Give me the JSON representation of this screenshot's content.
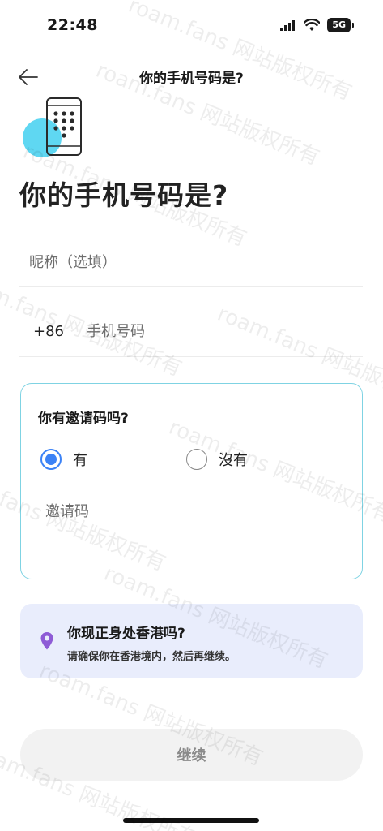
{
  "status_bar": {
    "time": "22:48",
    "battery": "5G",
    "icons": [
      "signal-icon",
      "wifi-icon",
      "battery-icon"
    ]
  },
  "nav": {
    "title": "你的手机号码是?",
    "back_icon": "back-arrow-icon"
  },
  "page": {
    "title": "你的手机号码是?",
    "hero_icon": "phone-keypad-icon"
  },
  "form": {
    "nickname_placeholder": "昵称（选填）",
    "nickname_value": "",
    "country_code": "+86",
    "phone_placeholder": "手机号码",
    "phone_value": ""
  },
  "invite": {
    "question": "你有邀请码吗?",
    "options": [
      {
        "label": "有",
        "checked": true
      },
      {
        "label": "沒有",
        "checked": false
      }
    ],
    "code_placeholder": "邀请码",
    "code_value": ""
  },
  "location": {
    "icon": "location-pin-icon",
    "title": "你现正身处香港吗?",
    "description": "请确保你在香港境内，然后再继续。"
  },
  "actions": {
    "continue_label": "继续"
  },
  "watermark": {
    "text": "roam.fans 网站版权所有"
  },
  "colors": {
    "accent": "#3b82f6",
    "card_border": "#7fd3e3",
    "location_bg": "#e9edfc",
    "pin": "#8e5bd6",
    "hero_blob": "#5fd7f2",
    "button_bg": "#f2f2f2",
    "button_text": "#8a8a8a"
  }
}
